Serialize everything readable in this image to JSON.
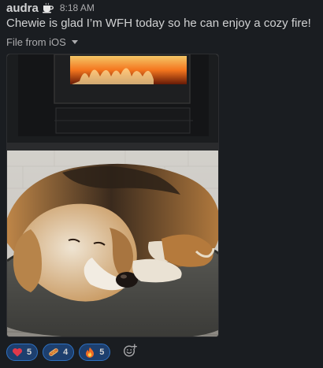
{
  "message": {
    "author": "audra",
    "status_emoji": "coffee-icon",
    "timestamp": "8:18 AM",
    "text": "Chewie is glad I’m WFH today so he can enjoy a cozy fire!",
    "file_source": "File from iOS"
  },
  "image": {
    "subject": "beagle-sleeping-by-fireplace"
  },
  "reactions": [
    {
      "icon": "heart-icon",
      "count": "5"
    },
    {
      "icon": "hotdog-icon",
      "count": "4"
    },
    {
      "icon": "fire-icon",
      "count": "5"
    }
  ],
  "add_reaction": {
    "icon": "add-reaction-icon"
  },
  "colors": {
    "background": "#1a1d21",
    "text": "#d1d2d3",
    "muted": "#ababad",
    "reaction_bg": "#1d3f6e",
    "reaction_border": "#2e70c0"
  }
}
